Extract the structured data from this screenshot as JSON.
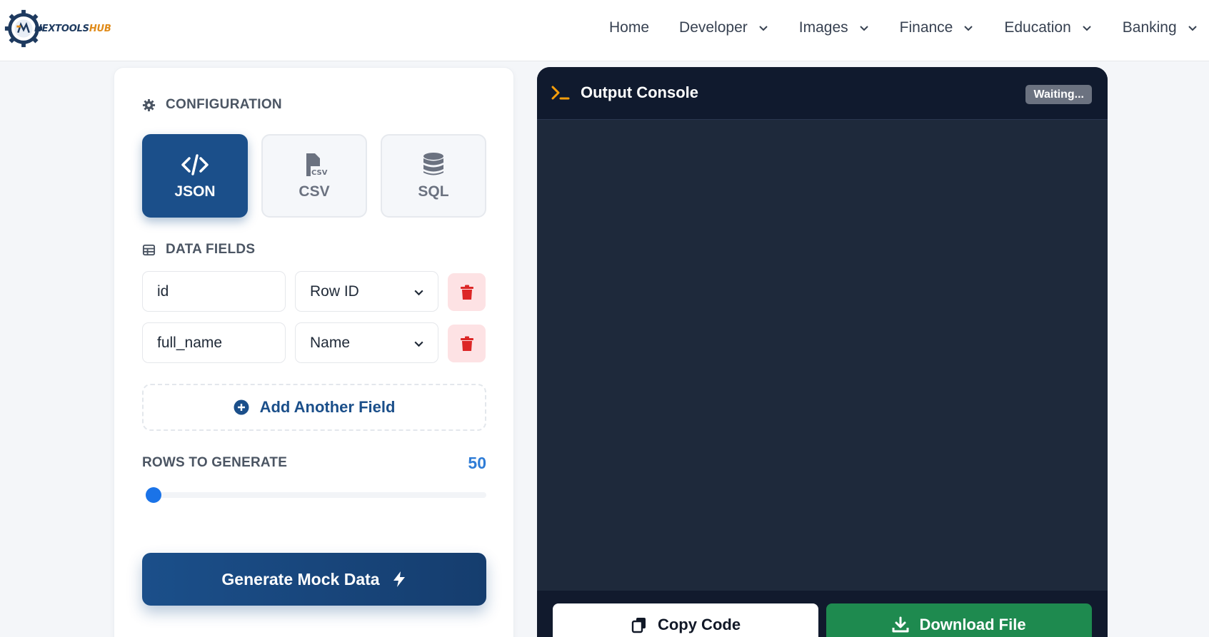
{
  "header": {
    "logo_text_main": "NEXTOOLS",
    "logo_text_accent": "HUB",
    "nav": {
      "home": "Home",
      "developer": "Developer",
      "images": "Images",
      "finance": "Finance",
      "education": "Education",
      "banking": "Banking"
    }
  },
  "config": {
    "title": "CONFIGURATION",
    "formats": {
      "json": "JSON",
      "csv": "CSV",
      "csv_icon_text": "CSV",
      "sql": "SQL",
      "selected": "JSON"
    },
    "fields_title": "DATA FIELDS",
    "fields": [
      {
        "name": "id",
        "type": "Row ID"
      },
      {
        "name": "full_name",
        "type": "Name"
      }
    ],
    "add_field_label": "Add Another Field",
    "rows_label": "ROWS TO GENERATE",
    "rows_value": "50",
    "rows_slider_fraction": 0.01,
    "generate_label": "Generate Mock Data"
  },
  "console": {
    "title": "Output Console",
    "status": "Waiting...",
    "copy_label": "Copy Code",
    "download_label": "Download File"
  },
  "colors": {
    "primary": "#1b4f8a",
    "accent_blue": "#2e7cd6",
    "danger": "#dc2626",
    "success": "#1e8a4f",
    "console_bg": "#1e293b",
    "prompt_icon": "#f59e0b"
  }
}
